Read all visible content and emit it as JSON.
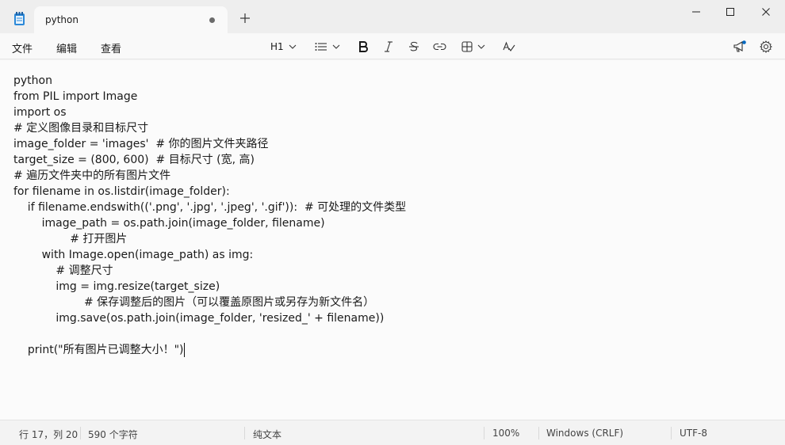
{
  "tab": {
    "title": "python"
  },
  "menu": {
    "file": "文件",
    "edit": "编辑",
    "view": "查看"
  },
  "toolbar": {
    "heading": "H1"
  },
  "editor": {
    "lines": [
      "python",
      "from PIL import Image",
      "import os",
      "# 定义图像目录和目标尺寸",
      "image_folder = 'images'  # 你的图片文件夹路径",
      "target_size = (800, 600)  # 目标尺寸 (宽, 高)",
      "# 遍历文件夹中的所有图片文件",
      "for filename in os.listdir(image_folder):",
      "    if filename.endswith(('.png', '.jpg', '.jpeg', '.gif')):  # 可处理的文件类型",
      "        image_path = os.path.join(image_folder, filename)",
      "                # 打开图片",
      "        with Image.open(image_path) as img:",
      "            # 调整尺寸",
      "            img = img.resize(target_size)",
      "                    # 保存调整后的图片（可以覆盖原图片或另存为新文件名）",
      "            img.save(os.path.join(image_folder, 'resized_' + filename))",
      "print(\"所有图片已调整大小！\")"
    ]
  },
  "status": {
    "position": "行 17，列 20",
    "chars": "590 个字符",
    "format": "纯文本",
    "zoom": "100%",
    "line_ending": "Windows (CRLF)",
    "encoding": "UTF-8"
  },
  "colors": {
    "accent": "#0067c0",
    "titlebar": "#eeeeee",
    "editor_bg": "#fbfbfb"
  }
}
